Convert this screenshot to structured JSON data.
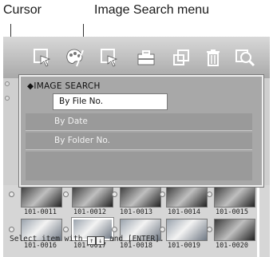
{
  "callouts": {
    "cursor": "Cursor",
    "menu": "Image Search menu"
  },
  "toolbar": {
    "icons": [
      "select-cursor-icon",
      "palette-icon",
      "search-cursor-icon",
      "toolbox-icon",
      "copy-icon",
      "trash-icon",
      "zoom-search-icon"
    ]
  },
  "menu": {
    "title": "◆IMAGE SEARCH",
    "items": [
      "By File No.",
      "By Date",
      "By Folder No."
    ],
    "selected": "By File No."
  },
  "thumbnails": {
    "row1": [
      "101-0011",
      "101-0012",
      "101-0013",
      "101-0014",
      "101-0015"
    ],
    "row2": [
      "101-0016",
      "101-0017",
      "101-0018",
      "101-0019",
      "101-0020"
    ]
  },
  "status": {
    "prefix": "Select item with",
    "keys": [
      "↑",
      "↓"
    ],
    "suffix": "and [ENTER]."
  }
}
